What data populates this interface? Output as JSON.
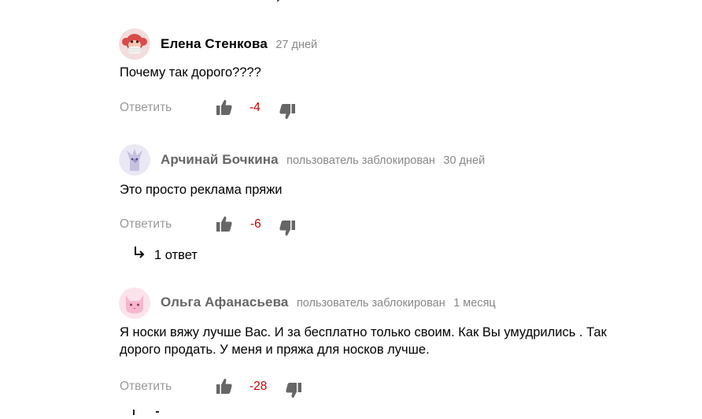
{
  "colors": {
    "negative_score": "#cc0000",
    "meta_gray": "#888888",
    "reply_gray": "#999999"
  },
  "comments": [
    {
      "author": "Елена Стенкова",
      "status": "",
      "date": "27 дней",
      "text": "Почему так дорого????",
      "reply_label": "Ответить",
      "score": "-4",
      "avatar_icon": "red-monkey-mask-icon"
    },
    {
      "author": "Арчинай Бочкина",
      "status": "пользователь заблокирован",
      "date": "30 дней",
      "text": "Это просто реклама пряжи",
      "reply_label": "Ответить",
      "score": "-6",
      "answers_label": "1 ответ",
      "avatar_icon": "lavender-creature-icon"
    },
    {
      "author": "Ольга Афанасьева",
      "status": "пользователь заблокирован",
      "date": "1 месяц",
      "text_line1": "Я носки вяжу лучше Вас. И за бесплатно только своим. Как Вы умудрились . Так",
      "text_line2": "дорого продать. У меня и пряжа для носков лучше.",
      "reply_label": "Ответить",
      "score": "-28",
      "avatar_icon": "pink-cat-icon"
    }
  ]
}
